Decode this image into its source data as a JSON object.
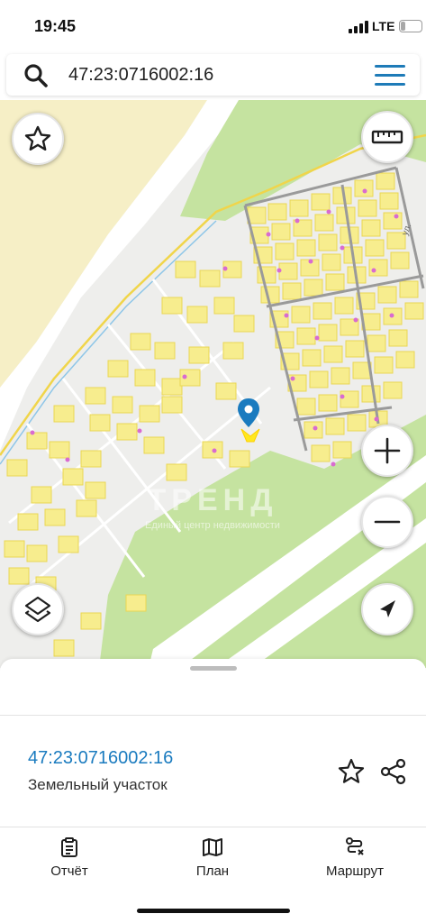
{
  "status_bar": {
    "time": "19:45",
    "network": "LTE",
    "battery": "21",
    "battery_level": 0.21
  },
  "search": {
    "icon": "search-icon",
    "query": "47:23:0716002:16",
    "menu_icon": "hamburger-menu-icon"
  },
  "map": {
    "watermark_title": "ТРЕНД",
    "watermark_subtitle": "Единый центр недвижимости",
    "street_label": "ул.",
    "colors": {
      "sand": "#f6efc6",
      "greenery": "#c5e3a0",
      "parcel_fill": "#f7ed8e",
      "parcel_stroke": "#ead654",
      "accent_blue": "#1a7bbf"
    },
    "controls": {
      "favorite": "star-icon",
      "ruler": "ruler-icon",
      "zoom_in": "plus-icon",
      "zoom_out": "minus-icon",
      "layers": "layers-icon",
      "locate": "navigation-arrow-icon"
    }
  },
  "sheet": {
    "parcel_number": "47:23:0716002:16",
    "parcel_type": "Земельный участок"
  },
  "tabs": [
    {
      "label": "Отчёт",
      "icon": "report-clipboard-icon"
    },
    {
      "label": "План",
      "icon": "map-plan-icon"
    },
    {
      "label": "Маршрут",
      "icon": "route-icon"
    }
  ]
}
